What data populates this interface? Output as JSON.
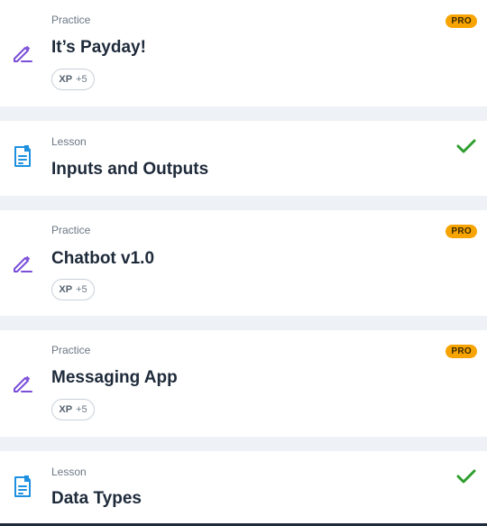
{
  "items": [
    {
      "type": "Practice",
      "title": "It’s Payday!",
      "pro_badge": "PRO",
      "xp_label": "XP",
      "xp_value": "+5",
      "icon": "pencil-icon",
      "status": "pro"
    },
    {
      "type": "Lesson",
      "title": "Inputs and Outputs",
      "icon": "document-icon",
      "status": "completed"
    },
    {
      "type": "Practice",
      "title": "Chatbot v1.0",
      "pro_badge": "PRO",
      "xp_label": "XP",
      "xp_value": "+5",
      "icon": "pencil-icon",
      "status": "pro"
    },
    {
      "type": "Practice",
      "title": "Messaging App",
      "pro_badge": "PRO",
      "xp_label": "XP",
      "xp_value": "+5",
      "icon": "pencil-icon",
      "status": "pro"
    },
    {
      "type": "Lesson",
      "title": "Data Types",
      "icon": "document-icon",
      "status": "completed"
    }
  ],
  "colors": {
    "practice_icon": "#7b4ed8",
    "lesson_icon": "#1e90e0",
    "pro_badge": "#f7a400",
    "check": "#2e9e2e",
    "divider": "#eef2f6"
  }
}
